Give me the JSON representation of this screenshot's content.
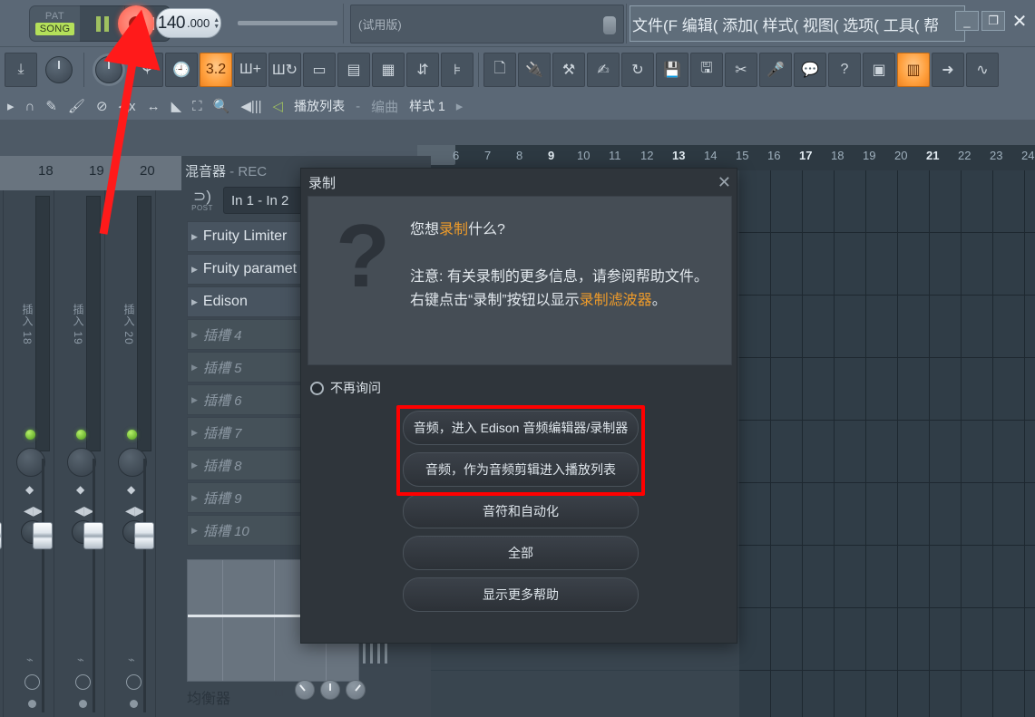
{
  "app": {
    "transport": {
      "pattern_label": "PAT",
      "song_label": "SONG",
      "tempo_whole": "140",
      "tempo_frac": ".000",
      "record_button_name": "record"
    },
    "hint_panel": {
      "text": "(试用版)"
    },
    "menubar": {
      "items_text": "文件(F 编辑( 添加( 样式( 视图( 选项( 工具( 帮"
    },
    "window_buttons": {
      "minimize": "_",
      "maximize": "❐",
      "close": "✕"
    },
    "toolbar2": {
      "playlist_label": "播放列表",
      "dash": "-",
      "arrangement": "编曲",
      "pattern": "样式 1",
      "chevron": "▸"
    }
  },
  "mixer": {
    "header_numbers": [
      "18",
      "19",
      "20"
    ],
    "channels": [
      {
        "label": "插入 18"
      },
      {
        "label": "插入 19"
      },
      {
        "label": "插入 20"
      }
    ]
  },
  "rack": {
    "title_main": "混音器",
    "title_sep": " - ",
    "title_state": "REC",
    "post_label": "POST",
    "io_value": "In 1 - In 2",
    "slots": [
      {
        "name": "Fruity Limiter",
        "empty": false
      },
      {
        "name": "Fruity paramet",
        "empty": false
      },
      {
        "name": "Edison",
        "empty": false
      },
      {
        "name": "插槽 4",
        "empty": true
      },
      {
        "name": "插槽 5",
        "empty": true
      },
      {
        "name": "插槽 6",
        "empty": true
      },
      {
        "name": "插槽 7",
        "empty": true
      },
      {
        "name": "插槽 8",
        "empty": true
      },
      {
        "name": "插槽 9",
        "empty": true
      },
      {
        "name": "插槽 10",
        "empty": true
      }
    ],
    "eq_label": "均衡器"
  },
  "playlist": {
    "ruler_ticks": [
      {
        "n": "6",
        "bold": false
      },
      {
        "n": "7",
        "bold": false
      },
      {
        "n": "8",
        "bold": false
      },
      {
        "n": "9",
        "bold": true
      },
      {
        "n": "10",
        "bold": false
      },
      {
        "n": "11",
        "bold": false
      },
      {
        "n": "12",
        "bold": false
      },
      {
        "n": "13",
        "bold": true
      },
      {
        "n": "14",
        "bold": false
      },
      {
        "n": "15",
        "bold": false
      },
      {
        "n": "16",
        "bold": false
      },
      {
        "n": "17",
        "bold": true
      },
      {
        "n": "18",
        "bold": false
      },
      {
        "n": "19",
        "bold": false
      },
      {
        "n": "20",
        "bold": false
      },
      {
        "n": "21",
        "bold": true
      },
      {
        "n": "22",
        "bold": false
      },
      {
        "n": "23",
        "bold": false
      },
      {
        "n": "24",
        "bold": false
      }
    ]
  },
  "dialog": {
    "title": "录制",
    "close_glyph": "✕",
    "question_glyph": "?",
    "line1_pre": "您想",
    "line1_hl": "录制",
    "line1_post": "什么?",
    "line2": "注意: 有关录制的更多信息，请参阅帮助文件。",
    "line3_pre": "右键点击“录制”按钮以显示",
    "line3_hl": "录制滤波器",
    "line3_post": "。",
    "dont_ask_label": "不再询问",
    "buttons": [
      {
        "label": "音频，进入 Edison 音频编辑器/录制器",
        "highlighted": true
      },
      {
        "label": "音频，作为音频剪辑进入播放列表",
        "highlighted": true
      },
      {
        "label": "音符和自动化",
        "highlighted": false
      },
      {
        "label": "全部",
        "highlighted": false
      },
      {
        "label": "显示更多帮助",
        "highlighted": false
      }
    ]
  },
  "annotation": {
    "arrow_color": "#ff1a1a",
    "points_to": "record-button"
  },
  "colors": {
    "accent_orange": "#ee9b2a",
    "highlight_red": "#ff0000",
    "song_green": "#b4e05a",
    "panel_bg": "#5b6876",
    "playlist_bg": "#303d47"
  }
}
